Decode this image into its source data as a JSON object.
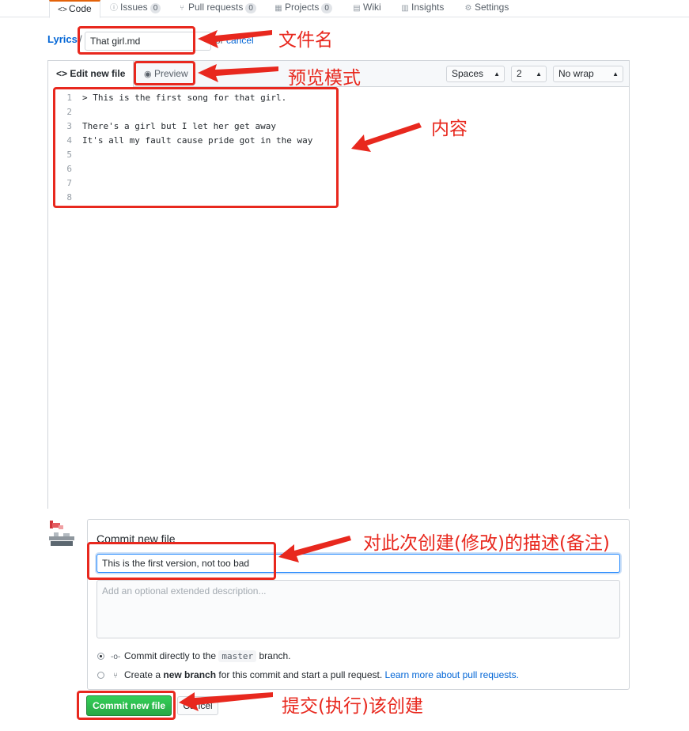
{
  "nav": {
    "tabs": [
      {
        "label": "Code",
        "icon": "code-icon"
      },
      {
        "label": "Issues",
        "icon": "issue-icon",
        "count": "0"
      },
      {
        "label": "Pull requests",
        "icon": "pull-request-icon",
        "count": "0"
      },
      {
        "label": "Projects",
        "icon": "project-icon",
        "count": "0"
      },
      {
        "label": "Wiki",
        "icon": "book-icon"
      },
      {
        "label": "Insights",
        "icon": "graph-icon"
      },
      {
        "label": "Settings",
        "icon": "gear-icon"
      }
    ]
  },
  "breadcrumb": {
    "repo": "Lyrics",
    "separator": "/",
    "filename": "That girl.md",
    "or": "or",
    "cancel": "cancel"
  },
  "editor": {
    "tab_edit": "Edit new file",
    "tab_preview": "Preview",
    "indent_mode": "Spaces",
    "indent_size": "2",
    "wrap_mode": "No wrap",
    "lines": [
      {
        "num": "1",
        "text": "> This is the first song for that girl."
      },
      {
        "num": "2",
        "text": ""
      },
      {
        "num": "3",
        "text": "There's a girl but I let her get away"
      },
      {
        "num": "4",
        "text": "It's all my fault cause pride got in the way"
      },
      {
        "num": "5",
        "text": ""
      },
      {
        "num": "6",
        "text": ""
      },
      {
        "num": "7",
        "text": ""
      },
      {
        "num": "8",
        "text": ""
      }
    ]
  },
  "commit": {
    "title": "Commit new file",
    "summary": "This is the first version, not too bad",
    "description_placeholder": "Add an optional extended description...",
    "option_direct_prefix": "Commit directly to the",
    "branch": "master",
    "option_direct_suffix": "branch.",
    "option_new_prefix": "Create a",
    "option_new_bold": "new branch",
    "option_new_suffix": "for this commit and start a pull request.",
    "learn_more": "Learn more about pull requests.",
    "commit_button": "Commit new file",
    "cancel_button": "Cancel"
  },
  "annotations": {
    "filename": "文件名",
    "preview": "预览模式",
    "content": "内容",
    "description": "对此次创建(修改)的描述(备注)",
    "commit": "提交(执行)该创建"
  },
  "colors": {
    "annotation_red": "#e8281e",
    "link_blue": "#0366d6",
    "commit_green": "#28a745",
    "active_tab_orange": "#e36209"
  }
}
